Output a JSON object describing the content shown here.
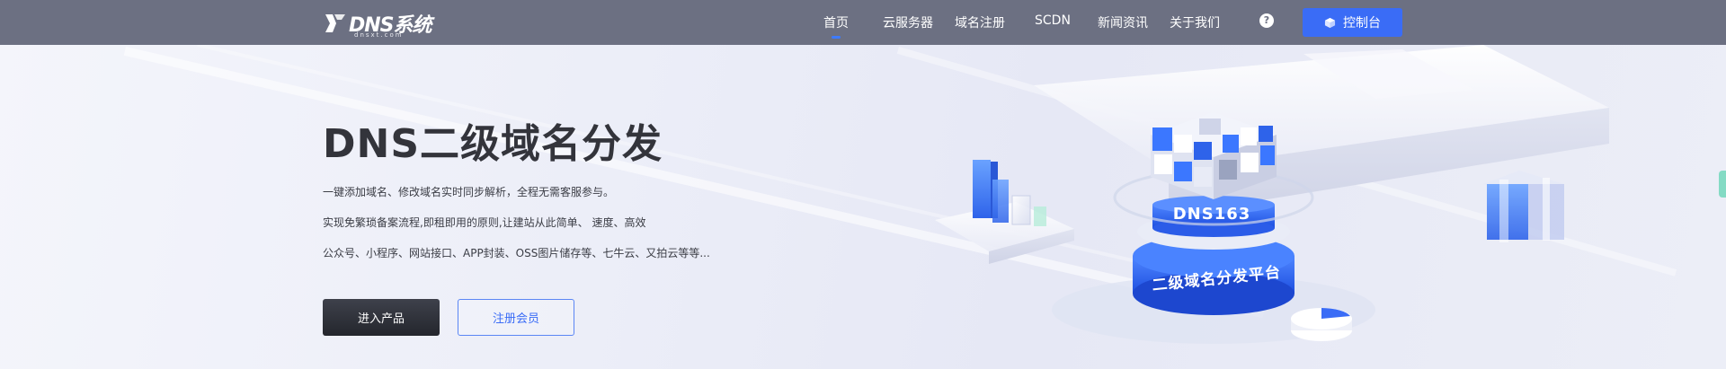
{
  "navbar": {
    "logo_text": "DNS系统",
    "logo_sub": "dnsxt.com",
    "items": [
      {
        "label": "首页",
        "active": true
      },
      {
        "label": "云服务器"
      },
      {
        "label": "域名注册"
      },
      {
        "label": "SCDN"
      },
      {
        "label": "新闻资讯"
      },
      {
        "label": "关于我们"
      }
    ],
    "help_glyph": "?",
    "console_label": "控制台",
    "accent_color": "#3a6cf6"
  },
  "hero": {
    "title": "DNS二级域名分发",
    "lines": [
      "一键添加域名、修改域名实时同步解析，全程无需客服参与。",
      "实现免繁琐备案流程,即租即用的原则,让建站从此简单、 速度、高效",
      "公众号、小程序、网站接口、APP封装、OSS图片储存等、七牛云、又拍云等等..."
    ],
    "primary_button": "进入产品",
    "secondary_button": "注册会员",
    "illustration": {
      "cylinder_top_label": "DNS163",
      "cylinder_bottom_label": "二级域名分发平台"
    }
  }
}
